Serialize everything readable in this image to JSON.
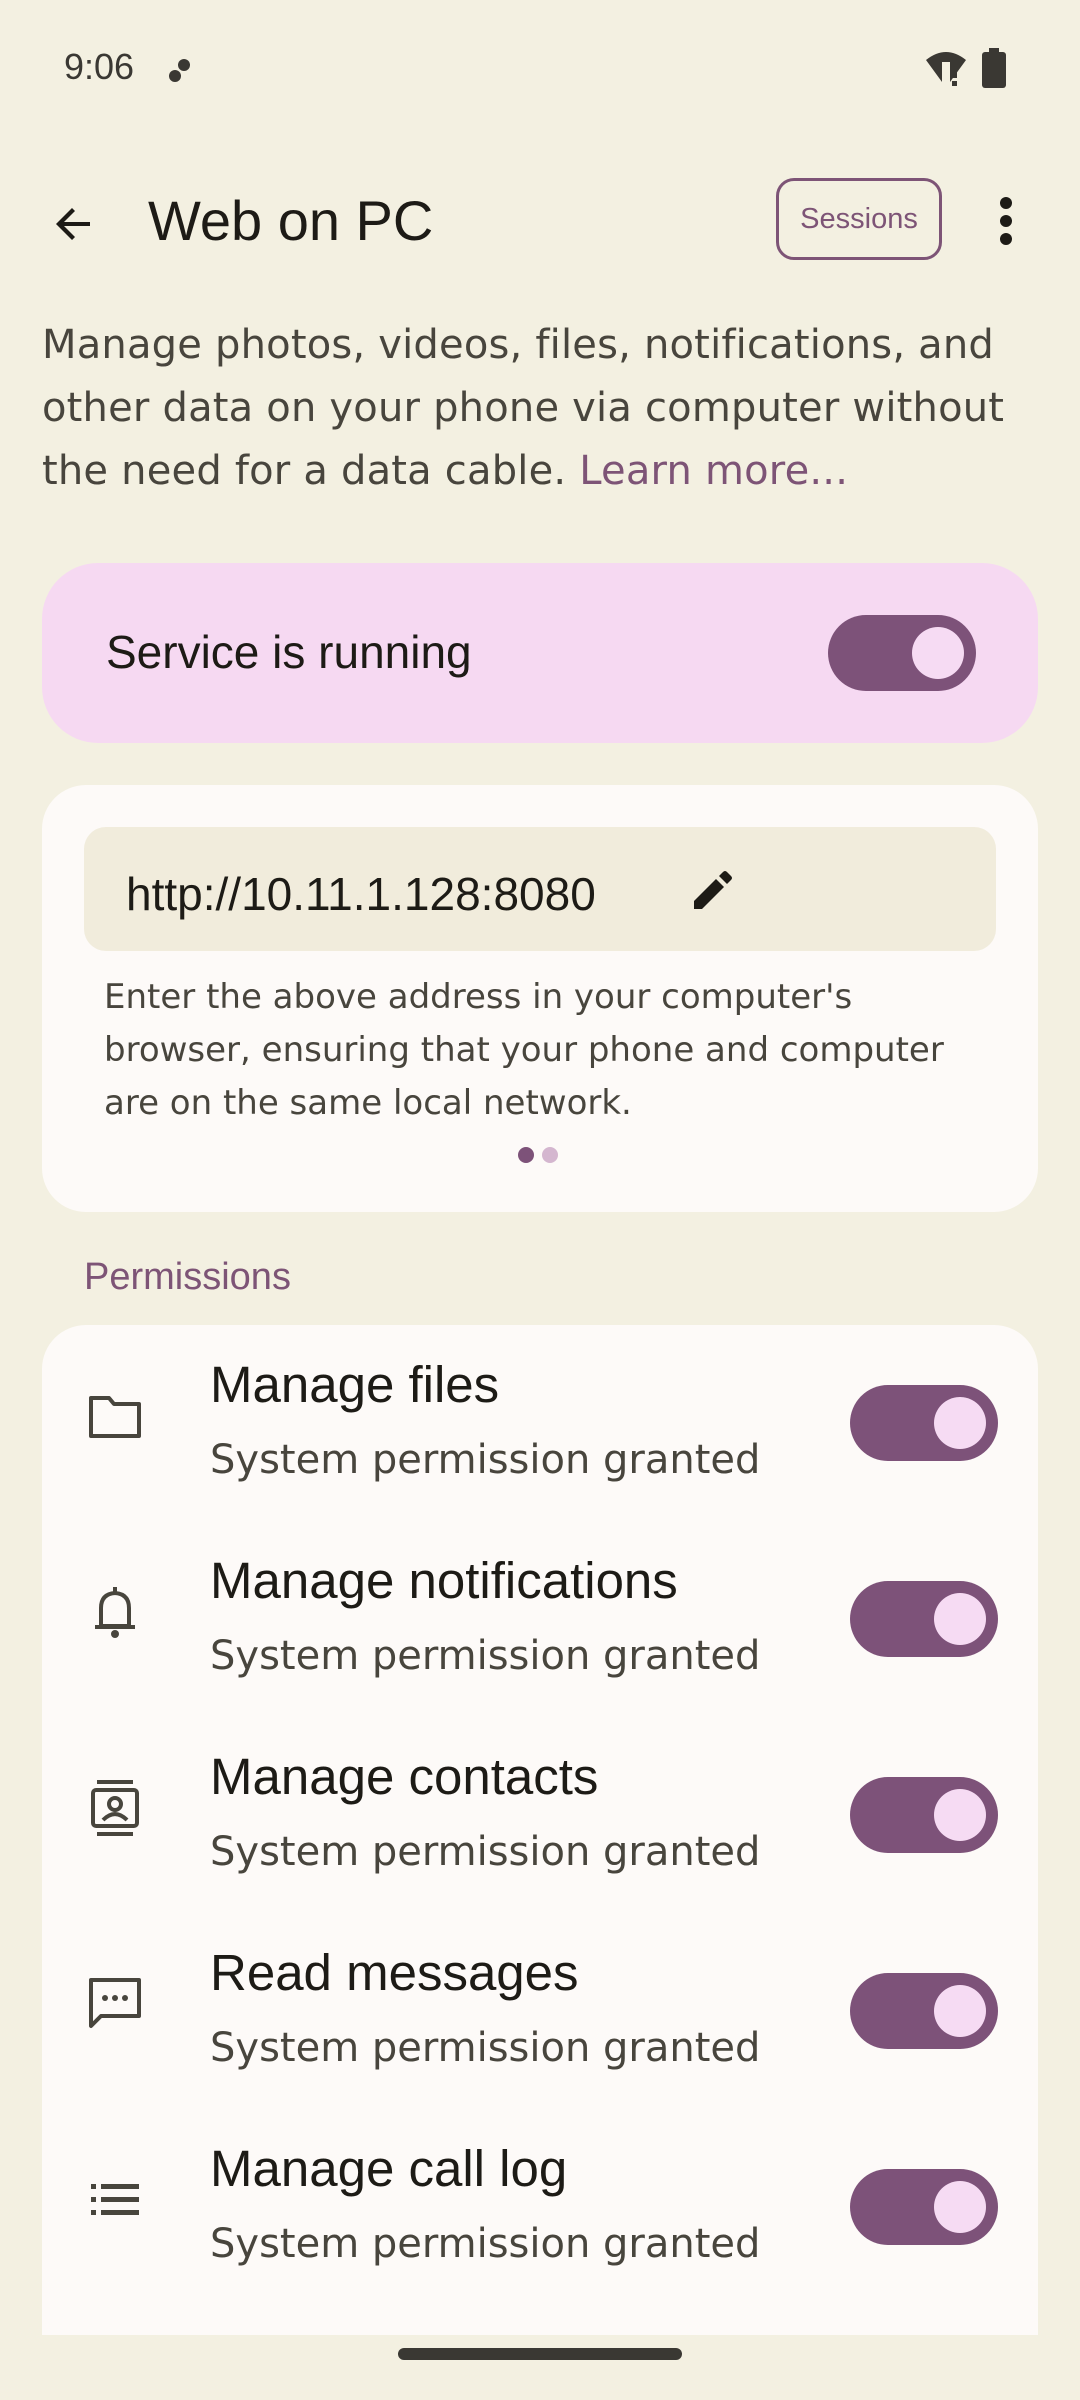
{
  "status_bar": {
    "time": "9:06"
  },
  "app_bar": {
    "title": "Web on PC",
    "sessions_label": "Sessions"
  },
  "intro": {
    "text": "Manage photos, videos, files, notifications, and other data on your phone via computer without the need for a data cable.",
    "link": "Learn more..."
  },
  "service": {
    "label": "Service is running",
    "enabled": true
  },
  "address": {
    "url": "http://10.11.1.128:8080",
    "hint": "Enter the above address in your computer's browser, ensuring that your phone and computer are on the same local network.",
    "page_index": 1,
    "page_count": 2
  },
  "permissions": {
    "section_title": "Permissions",
    "items": [
      {
        "title": "Manage files",
        "status": "System permission granted",
        "icon": "folder-icon",
        "enabled": true
      },
      {
        "title": "Manage notifications",
        "status": "System permission granted",
        "icon": "bell-icon",
        "enabled": true
      },
      {
        "title": "Manage contacts",
        "status": "System permission granted",
        "icon": "contacts-icon",
        "enabled": true
      },
      {
        "title": "Read messages",
        "status": "System permission granted",
        "icon": "message-icon",
        "enabled": true
      },
      {
        "title": "Manage call log",
        "status": "System permission granted",
        "icon": "list-icon",
        "enabled": true
      }
    ]
  },
  "colors": {
    "background": "#f3f0e1",
    "accent": "#7d5476",
    "service_card": "#f6d9f2",
    "toggle_track": "#7d5279"
  }
}
